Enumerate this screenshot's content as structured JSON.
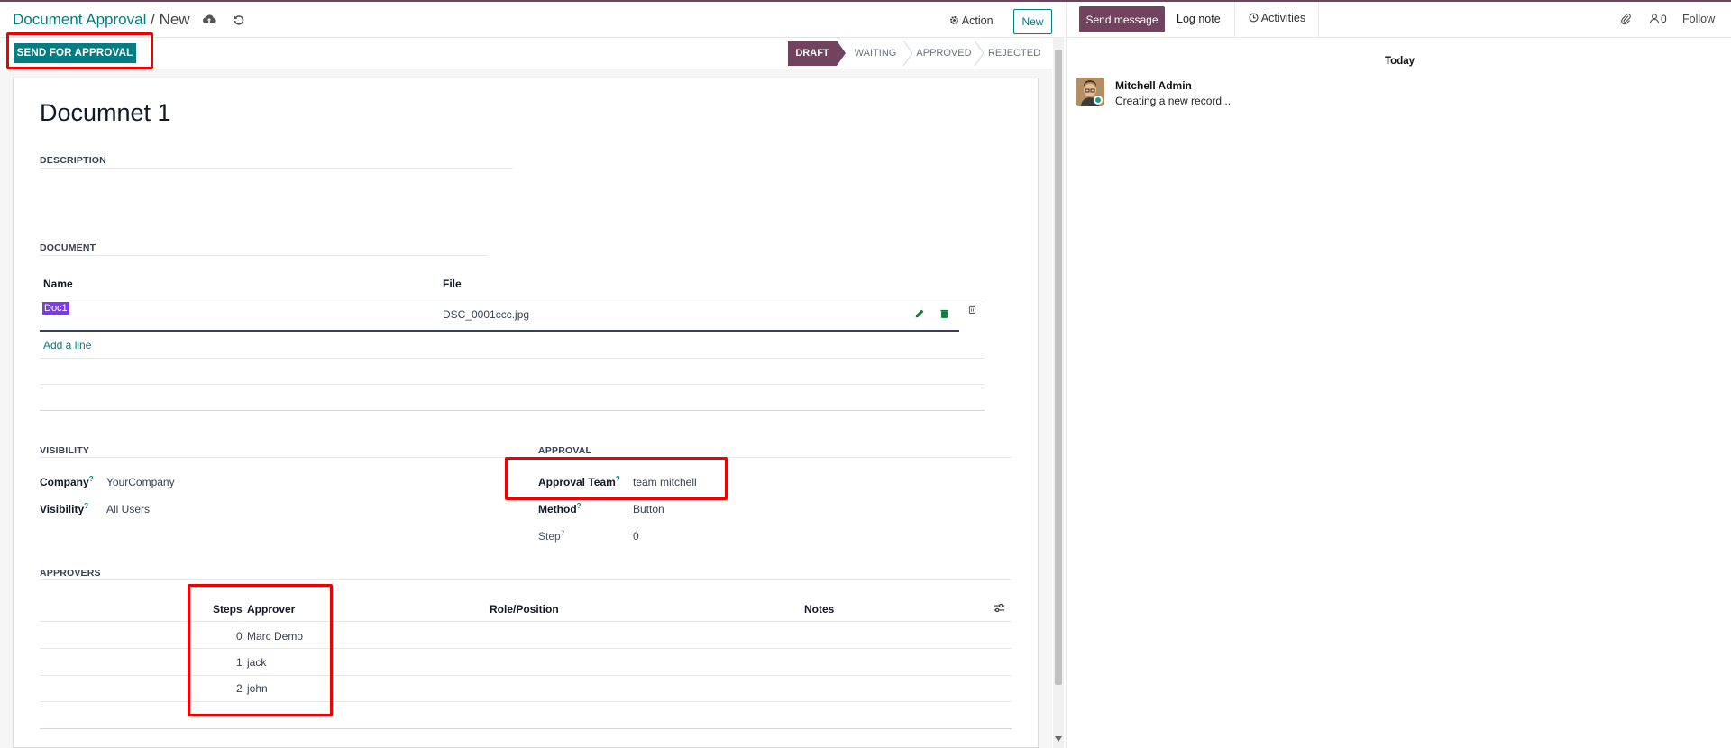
{
  "breadcrumb": {
    "root": "Document Approval",
    "separator": "/",
    "current": "New"
  },
  "control_panel": {
    "action_label": "Action",
    "new_label": "New"
  },
  "status_bar": {
    "send_for_approval_label": "SEND FOR APPROVAL",
    "stages": [
      "DRAFT",
      "WAITING",
      "APPROVED",
      "REJECTED"
    ],
    "active_stage": "DRAFT"
  },
  "form": {
    "title": "Documnet 1",
    "description_section": "DESCRIPTION",
    "document_section": "DOCUMENT",
    "document_table": {
      "columns": [
        "Name",
        "File"
      ],
      "rows": [
        {
          "name": "Doc1",
          "file": "DSC_0001ccc.jpg"
        }
      ],
      "add_line_label": "Add a line"
    },
    "visibility_section": "VISIBILITY",
    "company_label": "Company",
    "company_value": "YourCompany",
    "visibility_label": "Visibility",
    "visibility_value": "All Users",
    "help_mark": "?",
    "approval_section": "APPROVAL",
    "approval_team_label": "Approval Team",
    "approval_team_value": "team mitchell",
    "method_label": "Method",
    "method_value": "Button",
    "step_label": "Step",
    "step_value": "0",
    "approvers_section": "APPROVERS",
    "approvers_table": {
      "columns": [
        "Steps",
        "Approver",
        "Role/Position",
        "Notes"
      ],
      "rows": [
        {
          "step": "0",
          "approver": "Marc Demo"
        },
        {
          "step": "1",
          "approver": "jack"
        },
        {
          "step": "2",
          "approver": "john"
        }
      ]
    }
  },
  "chatter": {
    "send_message_label": "Send message",
    "log_note_label": "Log note",
    "activities_label": "Activities",
    "follower_count": "0",
    "follow_label": "Follow",
    "date_separator": "Today",
    "message": {
      "author": "Mitchell Admin",
      "body": "Creating a new record..."
    }
  },
  "colors": {
    "brand": "#71435f",
    "accent": "#017e84",
    "highlight": "#ee0000"
  },
  "icons": [
    "cloud-upload-icon",
    "undo-icon",
    "gear-icon",
    "pencil-icon",
    "trash-icon",
    "settings-sliders-icon",
    "clock-icon",
    "paperclip-icon",
    "user-icon"
  ]
}
